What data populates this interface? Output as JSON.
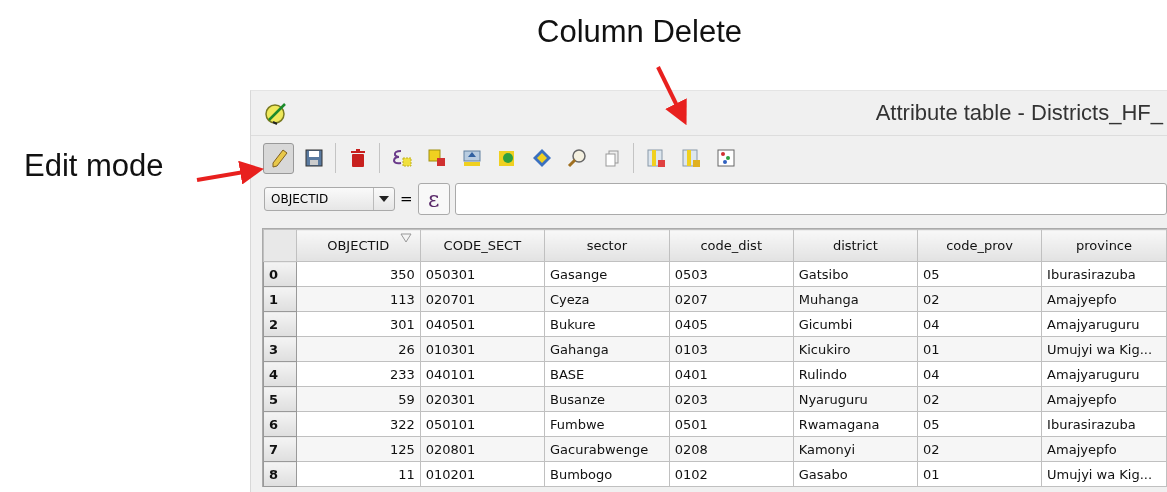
{
  "annotations": {
    "column_delete": "Column Delete",
    "edit_mode": "Edit mode"
  },
  "window": {
    "title": "Attribute table - Districts_HF_"
  },
  "toolbar": {
    "edit_mode_on": true
  },
  "filter": {
    "field": "OBJECTID",
    "operator": "=",
    "expression_button": "ε"
  },
  "table": {
    "columns": [
      {
        "label": "OBJECTID",
        "sorted": true
      },
      {
        "label": "CODE_SECT",
        "sorted": false
      },
      {
        "label": "sector",
        "sorted": false
      },
      {
        "label": "code_dist",
        "sorted": false
      },
      {
        "label": "district",
        "sorted": false
      },
      {
        "label": "code_prov",
        "sorted": false
      },
      {
        "label": "province",
        "sorted": false
      }
    ],
    "rows": [
      {
        "index": "0",
        "cells": [
          "350",
          "050301",
          "Gasange",
          "0503",
          "Gatsibo",
          "05",
          "Iburasirazuba"
        ]
      },
      {
        "index": "1",
        "cells": [
          "113",
          "020701",
          "Cyeza",
          "0207",
          "Muhanga",
          "02",
          "Amajyepfo"
        ]
      },
      {
        "index": "2",
        "cells": [
          "301",
          "040501",
          "Bukure",
          "0405",
          "Gicumbi",
          "04",
          "Amajyaruguru"
        ]
      },
      {
        "index": "3",
        "cells": [
          "26",
          "010301",
          "Gahanga",
          "0103",
          "Kicukiro",
          "01",
          "Umujyi wa Kig..."
        ]
      },
      {
        "index": "4",
        "cells": [
          "233",
          "040101",
          "BASE",
          "0401",
          "Rulindo",
          "04",
          "Amajyaruguru"
        ]
      },
      {
        "index": "5",
        "cells": [
          "59",
          "020301",
          "Busanze",
          "0203",
          "Nyaruguru",
          "02",
          "Amajyepfo"
        ]
      },
      {
        "index": "6",
        "cells": [
          "322",
          "050101",
          "Fumbwe",
          "0501",
          "Rwamagana",
          "05",
          "Iburasirazuba"
        ]
      },
      {
        "index": "7",
        "cells": [
          "125",
          "020801",
          "Gacurabwenge",
          "0208",
          "Kamonyi",
          "02",
          "Amajyepfo"
        ]
      },
      {
        "index": "8",
        "cells": [
          "11",
          "010201",
          "Bumbogo",
          "0102",
          "Gasabo",
          "01",
          "Umujyi wa Kig..."
        ]
      }
    ]
  }
}
